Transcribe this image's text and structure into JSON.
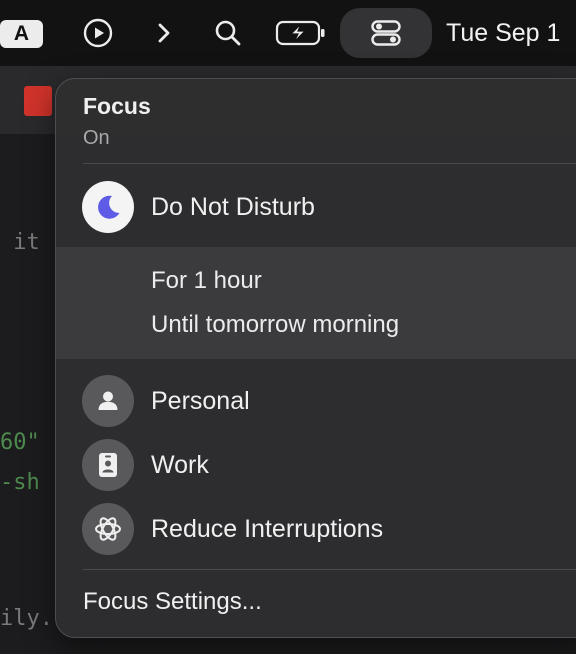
{
  "menubar": {
    "input_source_label": "A",
    "icons": [
      "input-source",
      "play-circle",
      "chevron-right",
      "search",
      "battery-charging",
      "control-center"
    ],
    "clock": "Tue Sep 1"
  },
  "focus_panel": {
    "title": "Focus",
    "status": "On",
    "do_not_disturb": {
      "label": "Do Not Disturb",
      "icon": "moon-icon",
      "accent_color": "#5e5ce6",
      "options": [
        {
          "label": "For 1 hour"
        },
        {
          "label": "Until tomorrow morning"
        }
      ]
    },
    "modes": [
      {
        "label": "Personal",
        "icon": "person-icon"
      },
      {
        "label": "Work",
        "icon": "badge-icon"
      },
      {
        "label": "Reduce Interruptions",
        "icon": "atom-icon"
      }
    ],
    "settings_label": "Focus Settings..."
  },
  "colors": {
    "menubar_bg": "#121212",
    "panel_bg": "#2e2e30",
    "selected_row_bg": "#3b3b3e"
  }
}
